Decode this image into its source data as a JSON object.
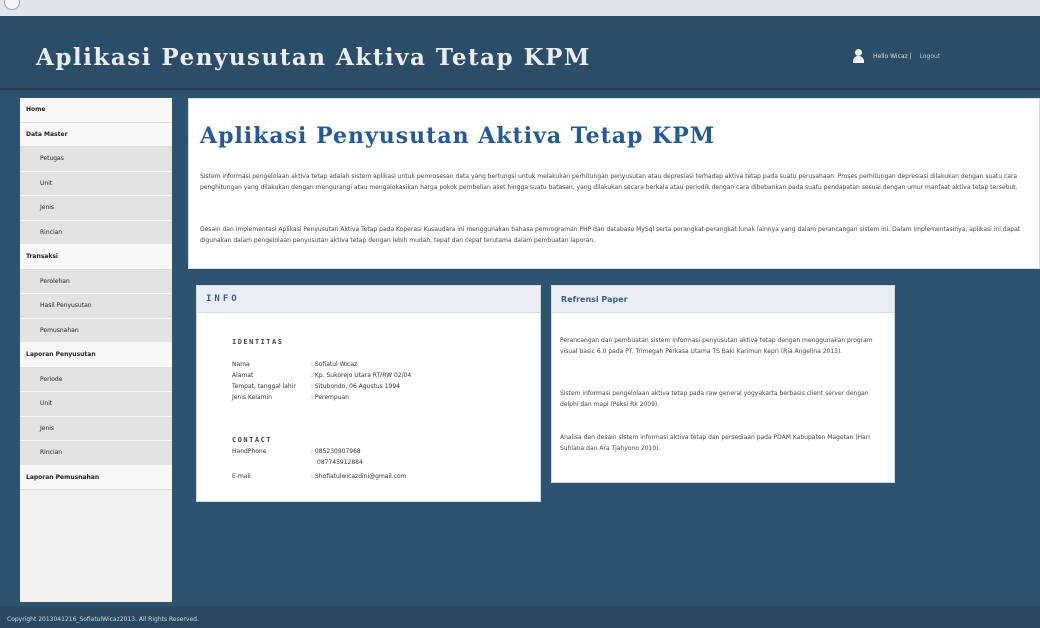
{
  "header": {
    "app_title": "Aplikasi Penyusutan Aktiva Tetap KPM",
    "user_greeting": "Hello Wicaz |",
    "logout_label": "Logout"
  },
  "sidebar": {
    "items": [
      {
        "label": "Home",
        "level": "top"
      },
      {
        "label": "Data Master",
        "level": "top"
      },
      {
        "label": "Petugas",
        "level": "sub"
      },
      {
        "label": "Unit",
        "level": "sub"
      },
      {
        "label": "Jenis",
        "level": "sub"
      },
      {
        "label": "Rincian",
        "level": "sub"
      },
      {
        "label": "Transaksi",
        "level": "top"
      },
      {
        "label": "Perolehan",
        "level": "sub"
      },
      {
        "label": "Hasil Penyusutan",
        "level": "sub"
      },
      {
        "label": "Pemusnahan",
        "level": "sub"
      },
      {
        "label": "Laporan Penyusutan",
        "level": "top"
      },
      {
        "label": "Periode",
        "level": "sub"
      },
      {
        "label": "Unit",
        "level": "sub"
      },
      {
        "label": "Jenis",
        "level": "sub"
      },
      {
        "label": "Rincian",
        "level": "sub"
      },
      {
        "label": "Laporan Pemusnahan",
        "level": "top"
      }
    ]
  },
  "main": {
    "title": "Aplikasi Penyusutan Aktiva Tetap KPM",
    "paragraph1": "Sistem informasi pengelolaan aktiva tetap adalah sistem aplikasi untuk pemrosesan data yang bertungsi untuk melakukan perhitungan penyusutan atau depresiasi terhadap aktiva tetap pada suatu perusahaan. Proses perhitungan depresiasi dilakukan dengan suatu cara penghitungan yang dilakukan dengan mengurangi atau mengalokasikan harga pokok pembelian aset hingga suatu batasan, yang dilakukan secara berkala atau periodik dengan cara dibebankan pada suatu pendapatan sesuai dengan umur manfaat aktiva tetap tersebut.",
    "paragraph2": "Desain dan implementasi Aplikasi Penyusutan Aktiva Tetap pada Koperasi Kusaudara ini menggunakan bahasa pemrograman PHP dan database MySql serta perangkat-perangkat lunak lainnya yang dalam perancangan sistem ini. Dalam implementasinya, aplikasi ini dapat digunakan dalam pengelolaan penyusutan aktiva tetap dengan lebih mudah, tepat dan cepat terutama dalam pembuatan laporan."
  },
  "info": {
    "heading": "INFO",
    "identitas_label": "IDENTITAS",
    "identity": [
      {
        "label": "Nama",
        "value": ": Sofiatul Wicaz"
      },
      {
        "label": "Alamat",
        "value": ": Kp. Sukorejo Utara RT/RW 02/04"
      },
      {
        "label": "Tempat, tanggal lahir",
        "value": ": Situbondo, 06 Agustus 1994"
      },
      {
        "label": "Jenis Kelamin",
        "value": ": Perempuan"
      }
    ],
    "contact_label": "CONTACT",
    "handphone_label": "HandPhone",
    "handphone_1": ": 085230907968",
    "handphone_2": "087745912884",
    "email_label": "E-mail",
    "email_value": ": Shofiatulwicazdini@gmail.com"
  },
  "references": {
    "heading": "Refrensi Paper",
    "items": [
      "Perancangan dan pembuatan sistem informasi penyusutan aktiva tetap dengan menggunakan program visual basic 6.0 pada PT. Trimegah Perkasa Utama TS Baki Karimun Kepri (Ria Angelina 2013).",
      "Sistem informasi pengelolaan aktiva tetap pada raw general yogyakarta berbasis client server dengan delphi dan mapi (Peksi Rk 2009).",
      "Analisa dan desain sistem informasi aktiva tetap dan persediaan pada PDAM Kabupaten Magetan (Hari Suhlana dan Ara Tjahyono 2010)."
    ]
  },
  "footer": {
    "text": "Copyright 2013041216_SofiatulWicaz2013. All Rights Reserved."
  }
}
